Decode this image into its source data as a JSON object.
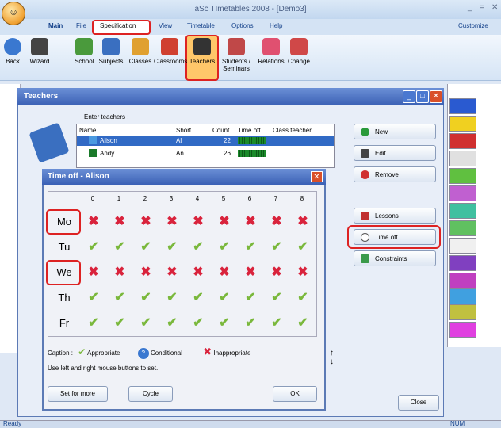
{
  "app": {
    "title": "aSc TImetables 2008 - [Demo3]",
    "customize": "Customize"
  },
  "tabs": [
    "Main",
    "File",
    "Specification",
    "View",
    "Timetable",
    "Options",
    "Help"
  ],
  "ribbon": [
    "Back",
    "Wizard",
    "School",
    "Subjects",
    "Classes",
    "Classrooms",
    "Teachers",
    "Students /\nSeminars",
    "Relations",
    "Change"
  ],
  "teachers_dialog": {
    "title": "Teachers",
    "enter_label": "Enter teachers :",
    "columns": [
      "Name",
      "Short",
      "Count",
      "Time off",
      "Class teacher"
    ],
    "rows": [
      {
        "name": "Alison",
        "short": "Al",
        "count": "22"
      },
      {
        "name": "Andy",
        "short": "An",
        "count": "26"
      }
    ],
    "buttons": {
      "new": "New",
      "edit": "Edit",
      "remove": "Remove",
      "lessons": "Lessons",
      "time_off": "Time off",
      "constraints": "Constraints",
      "close": "Close"
    }
  },
  "timeoff_dialog": {
    "title": "Time off - Alison",
    "periods": [
      "0",
      "1",
      "2",
      "3",
      "4",
      "5",
      "6",
      "7",
      "8"
    ],
    "days": [
      "Mo",
      "Tu",
      "We",
      "Th",
      "Fr"
    ],
    "unavailable_days": [
      "Mo",
      "We"
    ],
    "caption": {
      "label": "Caption :",
      "appropriate": "Appropriate",
      "conditional": "Conditional",
      "inappropriate": "Inappropriate"
    },
    "hint": "Use left and right mouse buttons to set.",
    "buttons": {
      "set_for_more": "Set for more",
      "cycle": "Cycle",
      "ok": "OK"
    }
  },
  "status": {
    "left": "Ready",
    "right": "NUM"
  }
}
